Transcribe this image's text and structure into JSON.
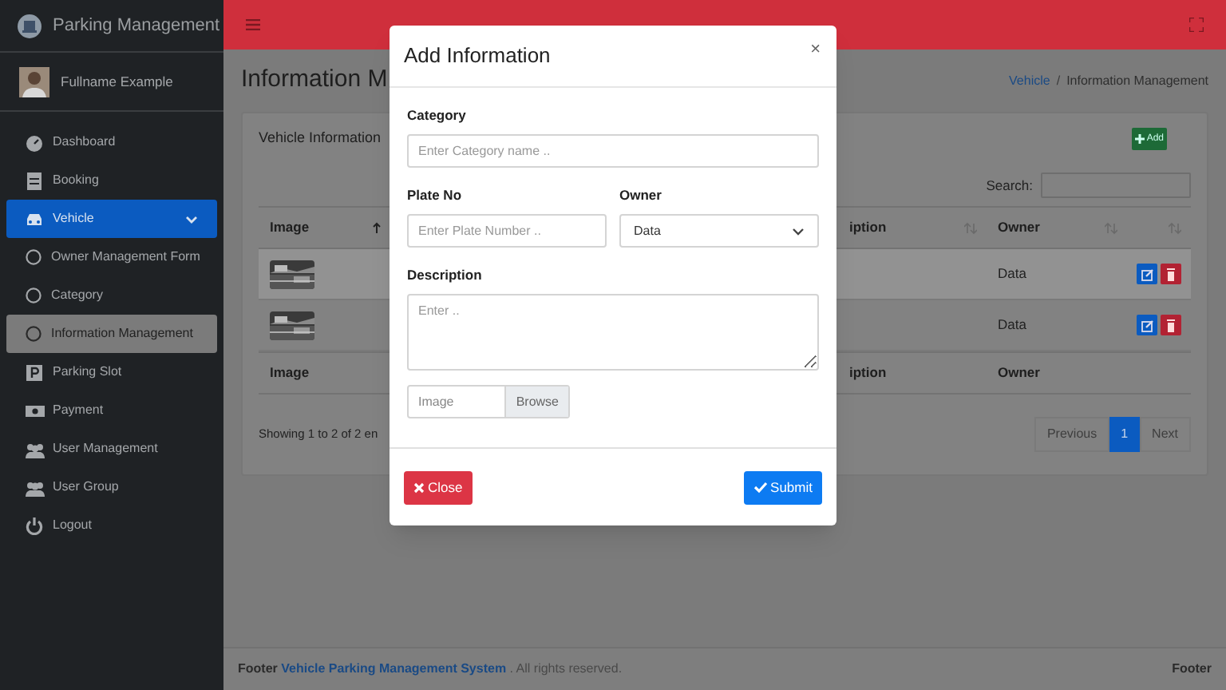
{
  "sidebar": {
    "brand": "Parking Management",
    "user": "Fullname Example",
    "items": [
      {
        "label": "Dashboard",
        "active": false
      },
      {
        "label": "Booking",
        "active": false
      },
      {
        "label": "Vehicle",
        "active": true,
        "expanded": true,
        "children": [
          {
            "label": "Owner Management Form",
            "selected": false
          },
          {
            "label": "Category",
            "selected": false
          },
          {
            "label": "Information Management",
            "selected": true
          }
        ]
      },
      {
        "label": "Parking Slot",
        "active": false
      },
      {
        "label": "Payment",
        "active": false
      },
      {
        "label": "User Management",
        "active": false
      },
      {
        "label": "User Group",
        "active": false
      },
      {
        "label": "Logout",
        "active": false
      }
    ]
  },
  "page": {
    "title": "Information M",
    "breadcrumb": [
      "Vehicle",
      "Information Management"
    ],
    "separator": "/"
  },
  "card": {
    "title": "Vehicle Information",
    "add_button": "Add",
    "search_label": "Search:"
  },
  "table": {
    "columns": [
      {
        "label": "Image",
        "sorted": true
      },
      {
        "label": "iption",
        "sorted": false
      },
      {
        "label": "Owner",
        "sorted": false
      }
    ],
    "rows": [
      {
        "owner": "Data",
        "highlighted": true
      },
      {
        "owner": "Data",
        "highlighted": false
      }
    ],
    "footer_columns": [
      "Image",
      "iption",
      "Owner"
    ],
    "info": "Showing 1 to 2 of 2 en",
    "pagination": [
      {
        "label": "Previous",
        "selected": false
      },
      {
        "label": "1",
        "selected": true
      },
      {
        "label": "Next",
        "selected": false
      }
    ]
  },
  "footer": {
    "prefix": "Footer",
    "link": "Vehicle Parking Management System",
    "suffix": ". All rights reserved.",
    "right": "Footer"
  },
  "modal": {
    "title": "Add Information",
    "close": "×",
    "category": {
      "label": "Category",
      "placeholder": "Enter Category name .."
    },
    "plate": {
      "label": "Plate No",
      "placeholder": "Enter Plate Number .."
    },
    "owner": {
      "label": "Owner",
      "value": "Data"
    },
    "description": {
      "label": "Description",
      "placeholder": "Enter .."
    },
    "file": {
      "placeholder": "Image",
      "button": "Browse"
    },
    "buttons": [
      {
        "label": "Close",
        "kind": "close"
      },
      {
        "label": "Submit",
        "kind": "submit"
      }
    ]
  }
}
